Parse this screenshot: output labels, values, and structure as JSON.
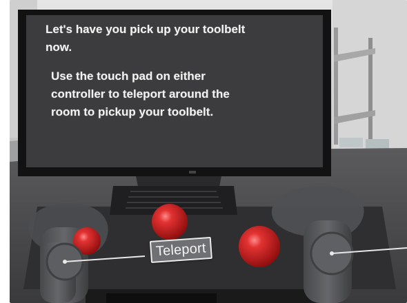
{
  "monitor": {
    "line1": "Let's have you pick up your toolbelt",
    "line2": "now.",
    "line3": "Use the touch pad on either",
    "line4": "controller to teleport around the",
    "line5": "room to pickup your toolbelt."
  },
  "teleport_label": "Teleport",
  "colors": {
    "room_wall": "#d8d8d8",
    "floor": "#4b4b4d",
    "monitor_screen": "#3c3c3e",
    "ball_red": "#d42424",
    "controller": "#5a5b5d"
  }
}
